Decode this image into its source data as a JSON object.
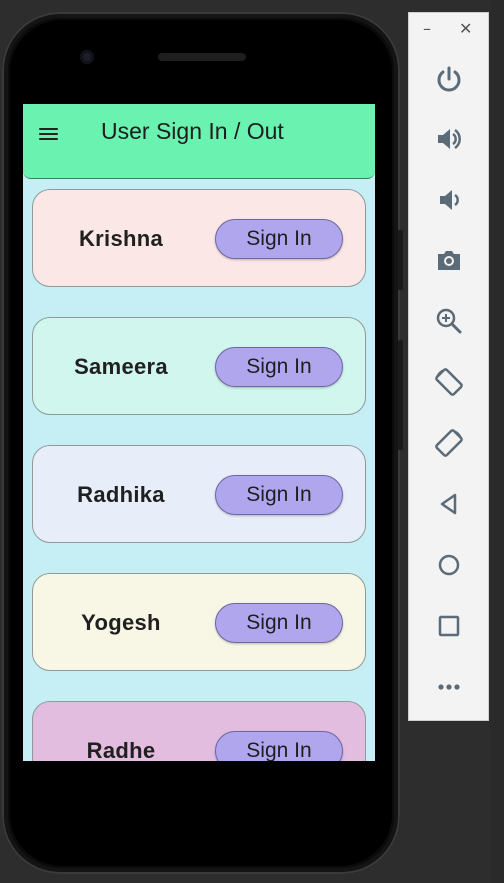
{
  "app": {
    "title": "User Sign In / Out",
    "appbar_color": "#6af2b0",
    "screen_bg": "#c5eef5"
  },
  "users": [
    {
      "name": "Krishna",
      "button_label": "Sign In",
      "card_color": "#fbe7e6"
    },
    {
      "name": "Sameera",
      "button_label": "Sign In",
      "card_color": "#d0f6ee"
    },
    {
      "name": "Radhika",
      "button_label": "Sign In",
      "card_color": "#e8eef9"
    },
    {
      "name": "Yogesh",
      "button_label": "Sign In",
      "card_color": "#f8f7e5"
    },
    {
      "name": "Radhe",
      "button_label": "Sign In",
      "card_color": "#e2bde0"
    }
  ],
  "emulator_toolbar": {
    "window_controls": [
      "minimize",
      "close"
    ],
    "minimize_label": "–",
    "close_label": "✕",
    "buttons": [
      "power-icon",
      "volume-up-icon",
      "volume-down-icon",
      "camera-icon",
      "zoom-icon",
      "rotate-left-icon",
      "rotate-right-icon",
      "back-icon",
      "home-icon",
      "overview-icon",
      "more-icon"
    ]
  }
}
